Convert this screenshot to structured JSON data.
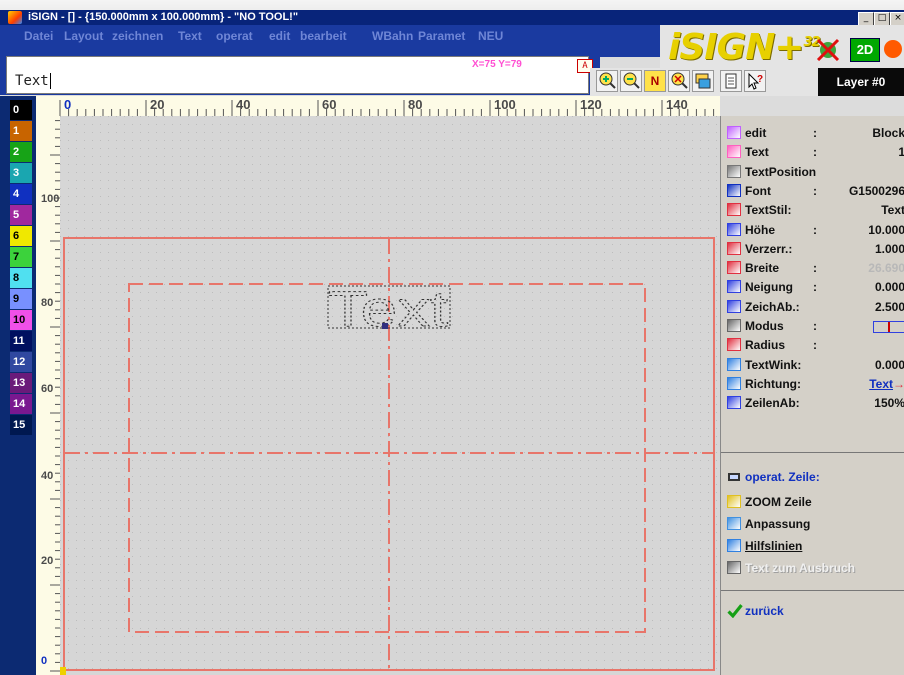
{
  "window": {
    "title": "iSIGN - [] - {150.000mm x 100.000mm} - \"NO TOOL!\"",
    "buttons": [
      "_",
      "□",
      "×"
    ]
  },
  "menu": [
    "Datei",
    "Layout",
    "zeichnen",
    "Text",
    "operat",
    "edit",
    "bearbeit",
    "WBahn",
    "Paramet",
    "NEU"
  ],
  "command": {
    "prefix": "T",
    "value": "ext",
    "coords": "X=75 Y=79",
    "accept_icon": "A"
  },
  "logo": {
    "text": "iSIGN+",
    "superscript": "32"
  },
  "mode_badge": "2D",
  "toolbar": {
    "icons": [
      "zoom-in-icon",
      "zoom-out-icon",
      "n-icon",
      "zoom-fit-icon",
      "layers-icon",
      "notepad-icon",
      "help-pointer-icon"
    ],
    "n_label": "N"
  },
  "layer_button": "Layer #0",
  "palette": [
    {
      "label": "0",
      "color": "#000000",
      "text_color": "#ffffff"
    },
    {
      "label": "1",
      "color": "#c86400",
      "text_color": "#ffffff"
    },
    {
      "label": "2",
      "color": "#17a317",
      "text_color": "#ffffff"
    },
    {
      "label": "3",
      "color": "#1aa6b0",
      "text_color": "#ffffff"
    },
    {
      "label": "4",
      "color": "#1030c0",
      "text_color": "#ffffff"
    },
    {
      "label": "5",
      "color": "#a0289e",
      "text_color": "#ffffff"
    },
    {
      "label": "6",
      "color": "#f0e800",
      "text_color": "#000000"
    },
    {
      "label": "7",
      "color": "#3cd23c",
      "text_color": "#000000"
    },
    {
      "label": "8",
      "color": "#50e0f0",
      "text_color": "#000000"
    },
    {
      "label": "9",
      "color": "#7890ff",
      "text_color": "#000000"
    },
    {
      "label": "10",
      "color": "#f050e8",
      "text_color": "#000000"
    },
    {
      "label": "11",
      "color": "#001060",
      "text_color": "#ffffff"
    },
    {
      "label": "12",
      "color": "#3048a0",
      "text_color": "#ffffff"
    },
    {
      "label": "13",
      "color": "#6a1a7a",
      "text_color": "#ffffff"
    },
    {
      "label": "14",
      "color": "#7a1890",
      "text_color": "#ffffff"
    },
    {
      "label": "15",
      "color": "#001850",
      "text_color": "#ffffff"
    }
  ],
  "ruler": {
    "top_labels": [
      "0",
      "20",
      "40",
      "60",
      "80",
      "100",
      "120",
      "140"
    ],
    "left_labels": [
      "100",
      "80",
      "60",
      "40",
      "20",
      "0"
    ]
  },
  "canvas": {
    "text_object": "Text",
    "frame_color": "#e8756a",
    "guide_color": "#e8756a"
  },
  "panel": {
    "properties": [
      {
        "label": "edit",
        "sep": ":",
        "value": "Block",
        "icon": "edit-icon"
      },
      {
        "label": "Text",
        "sep": ":",
        "value": "1",
        "icon": "text-icon"
      },
      {
        "label": "TextPosition",
        "sep": "",
        "value": "",
        "icon": "position-icon"
      },
      {
        "label": "Font",
        "sep": ":",
        "value": "G1500296",
        "icon": "font-icon"
      },
      {
        "label": "TextStil:",
        "sep": "",
        "value": "Text",
        "icon": "textstyle-icon"
      },
      {
        "label": "Höhe",
        "sep": ":",
        "value": "10.000",
        "icon": "height-icon"
      },
      {
        "label": "Verzerr.:",
        "sep": "",
        "value": "1.000",
        "icon": "distort-icon"
      },
      {
        "label": "Breite",
        "sep": ":",
        "value": "26.690",
        "icon": "width-icon",
        "dim": true
      },
      {
        "label": "Neigung",
        "sep": ":",
        "value": "0.000",
        "icon": "slant-icon"
      },
      {
        "label": "ZeichAb.:",
        "sep": "",
        "value": "2.500",
        "icon": "spacing-icon"
      },
      {
        "label": "Modus",
        "sep": ":",
        "value": "",
        "icon": "mode-icon"
      },
      {
        "label": "Radius",
        "sep": ":",
        "value": "",
        "icon": "radius-icon"
      },
      {
        "label": "TextWink:",
        "sep": "",
        "value": "0.000",
        "icon": "angle-icon"
      },
      {
        "label": "Richtung:",
        "sep": "",
        "value": "Text",
        "icon": "direction-icon"
      },
      {
        "label": "ZeilenAb:",
        "sep": "",
        "value": "150%",
        "icon": "linespacing-icon"
      }
    ],
    "operat_title": "operat. Zeile:",
    "actions": [
      {
        "label": "ZOOM Zeile",
        "icon": "zoom-line-icon",
        "dim": false
      },
      {
        "label": "Anpassung",
        "icon": "fit-icon",
        "dim": false
      },
      {
        "label": "Hilfslinien",
        "icon": "guides-icon",
        "dim": false
      },
      {
        "label": "Text zum Ausbruch",
        "icon": "explode-icon",
        "dim": true
      }
    ],
    "back": "zurück"
  }
}
